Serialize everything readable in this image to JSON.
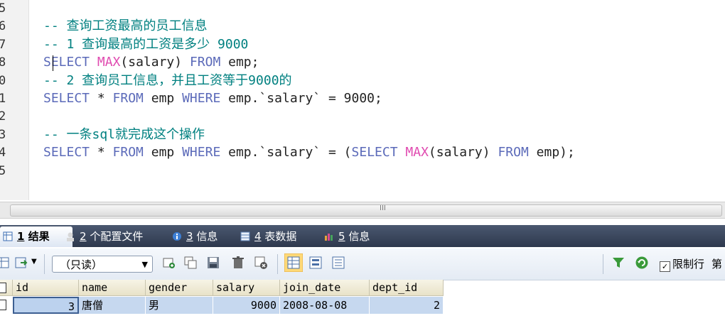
{
  "editor": {
    "line_numbers": [
      "5",
      "6",
      "7",
      "8",
      "0",
      "1",
      "2",
      "3",
      "4",
      "5"
    ],
    "lines": [
      {
        "segments": []
      },
      {
        "segments": [
          {
            "cls": "cm",
            "text": "-- 查询工资最高的员工信息"
          }
        ]
      },
      {
        "segments": [
          {
            "cls": "cm",
            "text": "-- 1 查询最高的工资是多少 9000"
          }
        ]
      },
      {
        "segments": [
          {
            "cls": "kw",
            "text": "SELECT"
          },
          {
            "cls": "tx",
            "text": " "
          },
          {
            "cls": "fn",
            "text": "MAX"
          },
          {
            "cls": "tx",
            "text": "(salary) "
          },
          {
            "cls": "kw",
            "text": "FROM"
          },
          {
            "cls": "tx",
            "text": " emp;"
          }
        ]
      },
      {
        "segments": [
          {
            "cls": "cm",
            "text": "-- 2 查询员工信息，并且工资等于9000的"
          }
        ]
      },
      {
        "segments": [
          {
            "cls": "kw",
            "text": "SELECT"
          },
          {
            "cls": "tx",
            "text": " * "
          },
          {
            "cls": "kw",
            "text": "FROM"
          },
          {
            "cls": "tx",
            "text": " emp "
          },
          {
            "cls": "kw",
            "text": "WHERE"
          },
          {
            "cls": "tx",
            "text": " emp.`salary` = 9000;"
          }
        ]
      },
      {
        "segments": []
      },
      {
        "segments": [
          {
            "cls": "cm",
            "text": "-- 一条sql就完成这个操作"
          }
        ]
      },
      {
        "segments": [
          {
            "cls": "kw",
            "text": "SELECT"
          },
          {
            "cls": "tx",
            "text": " * "
          },
          {
            "cls": "kw",
            "text": "FROM"
          },
          {
            "cls": "tx",
            "text": " emp "
          },
          {
            "cls": "kw",
            "text": "WHERE"
          },
          {
            "cls": "tx",
            "text": " emp.`salary` = ("
          },
          {
            "cls": "kw",
            "text": "SELECT"
          },
          {
            "cls": "tx",
            "text": " "
          },
          {
            "cls": "fn",
            "text": "MAX"
          },
          {
            "cls": "tx",
            "text": "(salary) "
          },
          {
            "cls": "kw",
            "text": "FROM"
          },
          {
            "cls": "tx",
            "text": " emp);"
          }
        ]
      },
      {
        "segments": []
      }
    ],
    "scroll_grip": "III"
  },
  "tabs": [
    {
      "num": "1",
      "label": " 结果",
      "active": true
    },
    {
      "num": "2",
      "label": " 个配置文件",
      "active": false
    },
    {
      "num": "3",
      "label": " 信息",
      "active": false
    },
    {
      "num": "4",
      "label": " 表数据",
      "active": false
    },
    {
      "num": "5",
      "label": " 信息",
      "active": false
    }
  ],
  "toolbar": {
    "mode_select": "（只读）",
    "limit_checked": true,
    "limit_label": "限制行",
    "limit_cut": "第"
  },
  "grid": {
    "columns": [
      "id",
      "name",
      "gender",
      "salary",
      "join_date",
      "dept_id"
    ],
    "rows": [
      {
        "id": "3",
        "name": "唐僧",
        "gender": "男",
        "salary": "9000",
        "join_date": "2008-08-08",
        "dept_id": "2"
      }
    ]
  },
  "colors": {
    "comment": "#008080",
    "keyword": "#5b6ab9",
    "function": "#e04bb0",
    "tabbar": "#3a465b",
    "row_selected": "#c6d8ef"
  }
}
